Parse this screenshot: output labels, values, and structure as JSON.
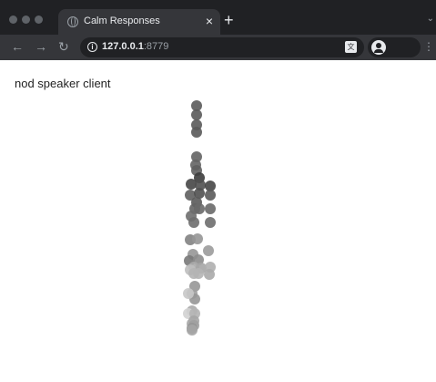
{
  "tab": {
    "title": "Calm Responses"
  },
  "address": {
    "host": "127.0.0.1",
    "port": ":8779"
  },
  "page": {
    "heading": "nod speaker client"
  },
  "colors": {
    "chrome_dark": "#202124",
    "chrome_mid": "#35363a"
  },
  "dots": [
    {
      "grey": 90
    },
    {
      "grey": 90
    },
    {
      "grey": 90
    },
    {
      "grey": 90
    },
    {
      "grey": 100
    },
    {
      "grey": 100
    },
    {
      "grey": 95
    },
    {
      "grey": 60
    },
    {
      "grey": 70
    },
    {
      "grey": 80
    },
    {
      "grey": 70
    },
    {
      "grey": 95
    },
    {
      "grey": 80
    },
    {
      "grey": 90
    },
    {
      "grey": 90
    },
    {
      "grey": 100
    },
    {
      "grey": 105
    },
    {
      "grey": 105
    },
    {
      "grey": 110
    },
    {
      "grey": 110
    },
    {
      "grey": 110
    },
    {
      "grey": 130
    },
    {
      "grey": 150
    },
    {
      "grey": 150
    },
    {
      "grey": 120
    },
    {
      "grey": 140
    },
    {
      "grey": 155
    },
    {
      "grey": 170
    },
    {
      "grey": 190
    },
    {
      "grey": 165
    },
    {
      "grey": 175
    },
    {
      "grey": 180
    },
    {
      "grey": 170
    },
    {
      "grey": 180
    },
    {
      "grey": 150
    },
    {
      "grey": 160
    },
    {
      "grey": 150
    },
    {
      "grey": 200
    },
    {
      "grey": 170
    },
    {
      "grey": 210
    },
    {
      "grey": 180
    },
    {
      "grey": 165
    },
    {
      "grey": 170
    },
    {
      "grey": 160
    },
    {
      "grey": 150
    },
    {
      "grey": 165
    }
  ]
}
